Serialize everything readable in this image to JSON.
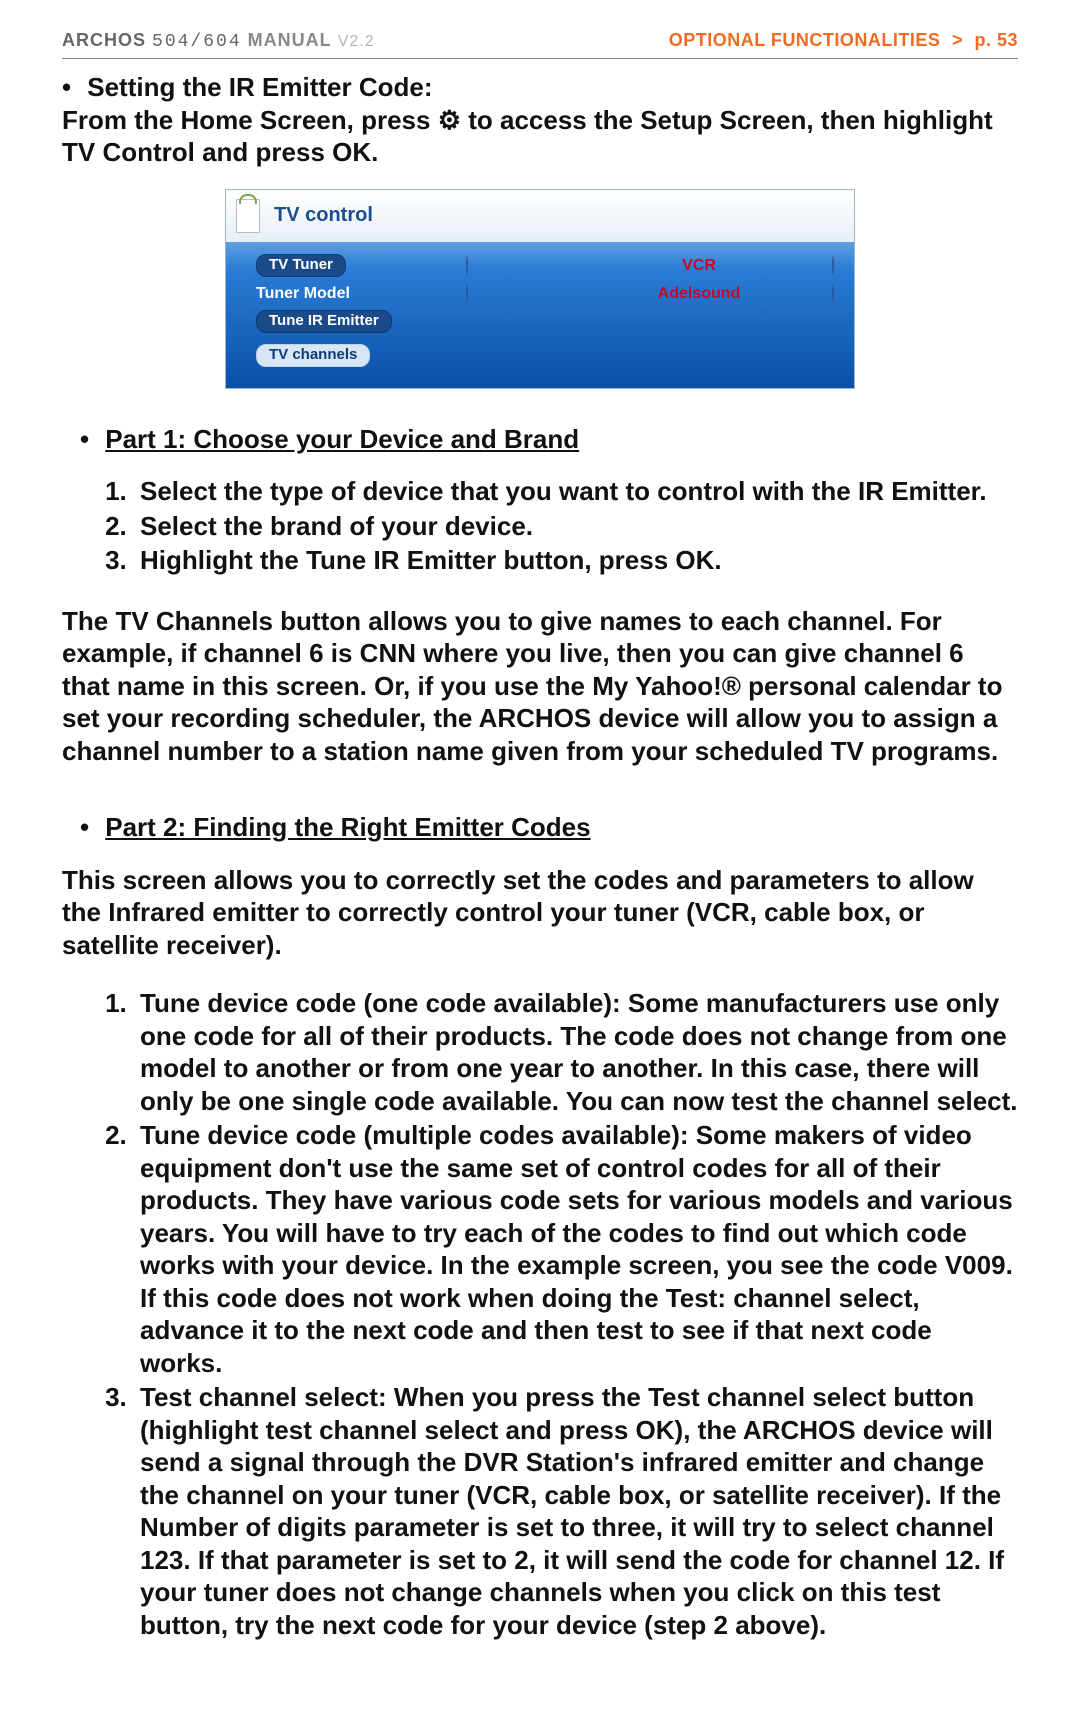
{
  "header": {
    "brand": "ARCHOS",
    "models": "504/604",
    "manual": "MANUAL",
    "version": "V2.2",
    "section": "OPTIONAL FUNCTIONALITIES",
    "page": "p. 53"
  },
  "intro": {
    "bullet_label": "Setting the IR Emitter Code:",
    "line1_a": "From the Home Screen, press ",
    "gear_sym": "⚙",
    "line1_b": " to access the Setup Screen, then highlight TV Control and press ",
    "ok_sym": "OK",
    "line1_c": "."
  },
  "screenshot": {
    "title": "TV control",
    "rows": {
      "tv_tuner": "TV Tuner",
      "tuner_model": "Tuner Model",
      "tune_ir": "Tune IR Emitter",
      "tv_channels": "TV channels",
      "vcr": "VCR",
      "adelsound": "Adelsound"
    }
  },
  "part1": {
    "heading": "Part 1: Choose your Device and Brand",
    "items": [
      "Select the type of device that you want to control with the IR Emitter.",
      "Select the brand of your device.",
      "Highlight the Tune IR Emitter button, press "
    ],
    "ok_suffix": "OK."
  },
  "tv_channels_para": "The TV Channels button allows you to give names to each channel. For example, if channel 6 is CNN where you live, then you can give channel 6 that name in this screen. Or, if you use the My Yahoo!® personal calendar to set your recording scheduler, the ARCHOS device will allow you to assign a channel number to a station name given from your scheduled TV programs.",
  "part2": {
    "heading": "Part 2: Finding the Right Emitter Codes",
    "intro": "This screen allows you to correctly set the codes and parameters to allow the Infrared emitter to correctly control your tuner (VCR, cable box, or satellite receiver).",
    "items": [
      "Tune device code (one code available): Some manufacturers use only one code for all of their products. The code does not change from one model to another or from one year to another. In this case, there will only be one single code available. You can now test the channel select.",
      "Tune device code (multiple codes available): Some makers of video equipment don't use the same set of control codes for all of their products. They have various code sets for various models and various years. You will have to try each of the codes to find out which code works with your device. In the example screen, you see the code V009. If this code does not work when doing the Test: channel select, advance it to the next code and then test to see if that next code works.",
      "Test channel select: When you press the Test channel select button (highlight test channel select and press OK), the ARCHOS device will send a signal through the DVR Station's infrared emitter and change the channel on your tuner (VCR, cable box, or satellite receiver). If the Number of digits parameter is set to three, it will try to select channel 123. If that parameter is set to 2, it will send the code for channel 12. If your tuner does not change channels when you click on this test button, try the next code for your device (step 2 above)."
    ]
  }
}
